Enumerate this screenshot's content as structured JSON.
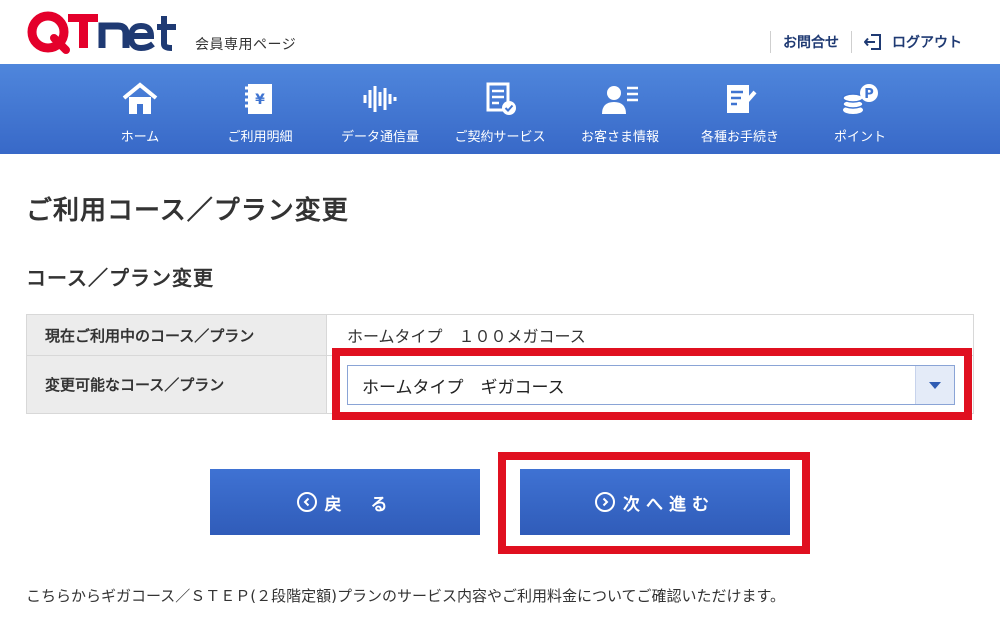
{
  "header": {
    "logo_text": "QTnet",
    "logo_subtitle": "会員専用ページ",
    "contact_label": "お問合せ",
    "logout_label": "ログアウト"
  },
  "nav": {
    "items": [
      {
        "label": "ホーム",
        "icon": "home-icon"
      },
      {
        "label": "ご利用明細",
        "icon": "statement-icon"
      },
      {
        "label": "データ通信量",
        "icon": "data-usage-icon"
      },
      {
        "label": "ご契約サービス",
        "icon": "contract-service-icon"
      },
      {
        "label": "お客さま情報",
        "icon": "customer-info-icon"
      },
      {
        "label": "各種お手続き",
        "icon": "procedures-icon"
      },
      {
        "label": "ポイント",
        "icon": "points-icon"
      }
    ]
  },
  "page_title": "ご利用コース／プラン変更",
  "section_title": "コース／プラン変更",
  "table": {
    "current_label": "現在ご利用中のコース／プラン",
    "current_value": "ホームタイプ　１００メガコース",
    "changeable_label": "変更可能なコース／プラン",
    "selected_value": "ホームタイプ　ギガコース"
  },
  "buttons": {
    "back_label": "戻　る",
    "next_label": "次へ進む"
  },
  "note": "こちらからギガコース／ＳＴＥＰ(２段階定額)プランのサービス内容やご利用料金についてご確認いただけます。",
  "colors": {
    "nav_blue": "#3f74d1",
    "button_blue": "#3566c6",
    "logo_red": "#e4002b",
    "logo_navy": "#1f3a73",
    "highlight_red": "#e01020"
  }
}
